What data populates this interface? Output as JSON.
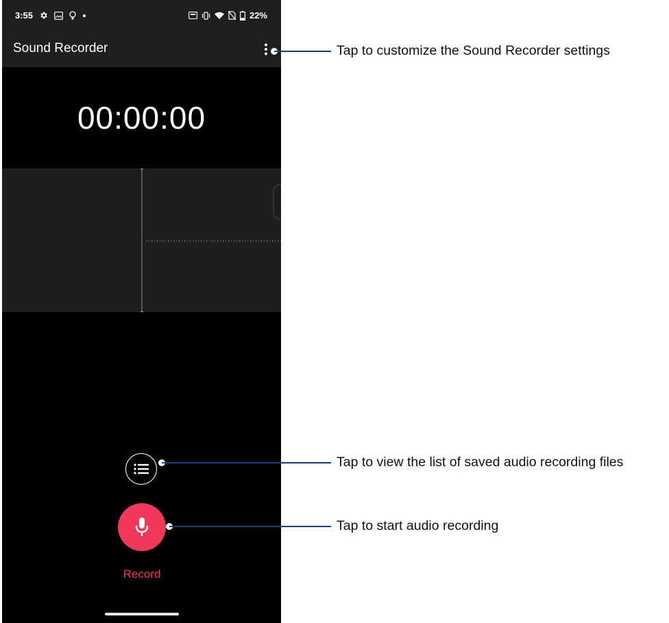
{
  "status_bar": {
    "time": "3:55",
    "battery": "22%",
    "left_icons": [
      "gear-icon",
      "image-icon",
      "lightbulb-icon",
      "dot-icon"
    ],
    "right_icons": [
      "nfc-icon",
      "vibrate-icon",
      "wifi-icon",
      "no-sim-icon",
      "battery-icon"
    ]
  },
  "app_bar": {
    "title": "Sound Recorder",
    "menu_icon": "more-vert-icon"
  },
  "recorder": {
    "timer": "00:00:00",
    "record_label": "Record",
    "record_icon": "microphone-icon",
    "list_icon": "list-icon"
  },
  "callouts": {
    "settings": "Tap to customize the Sound Recorder settings",
    "list": "Tap to view the list of saved audio recording files",
    "record": "Tap to start audio recording"
  },
  "colors": {
    "record_accent": "#f0395a",
    "bar_background": "#1f1f1f",
    "screen_background": "#000000"
  }
}
